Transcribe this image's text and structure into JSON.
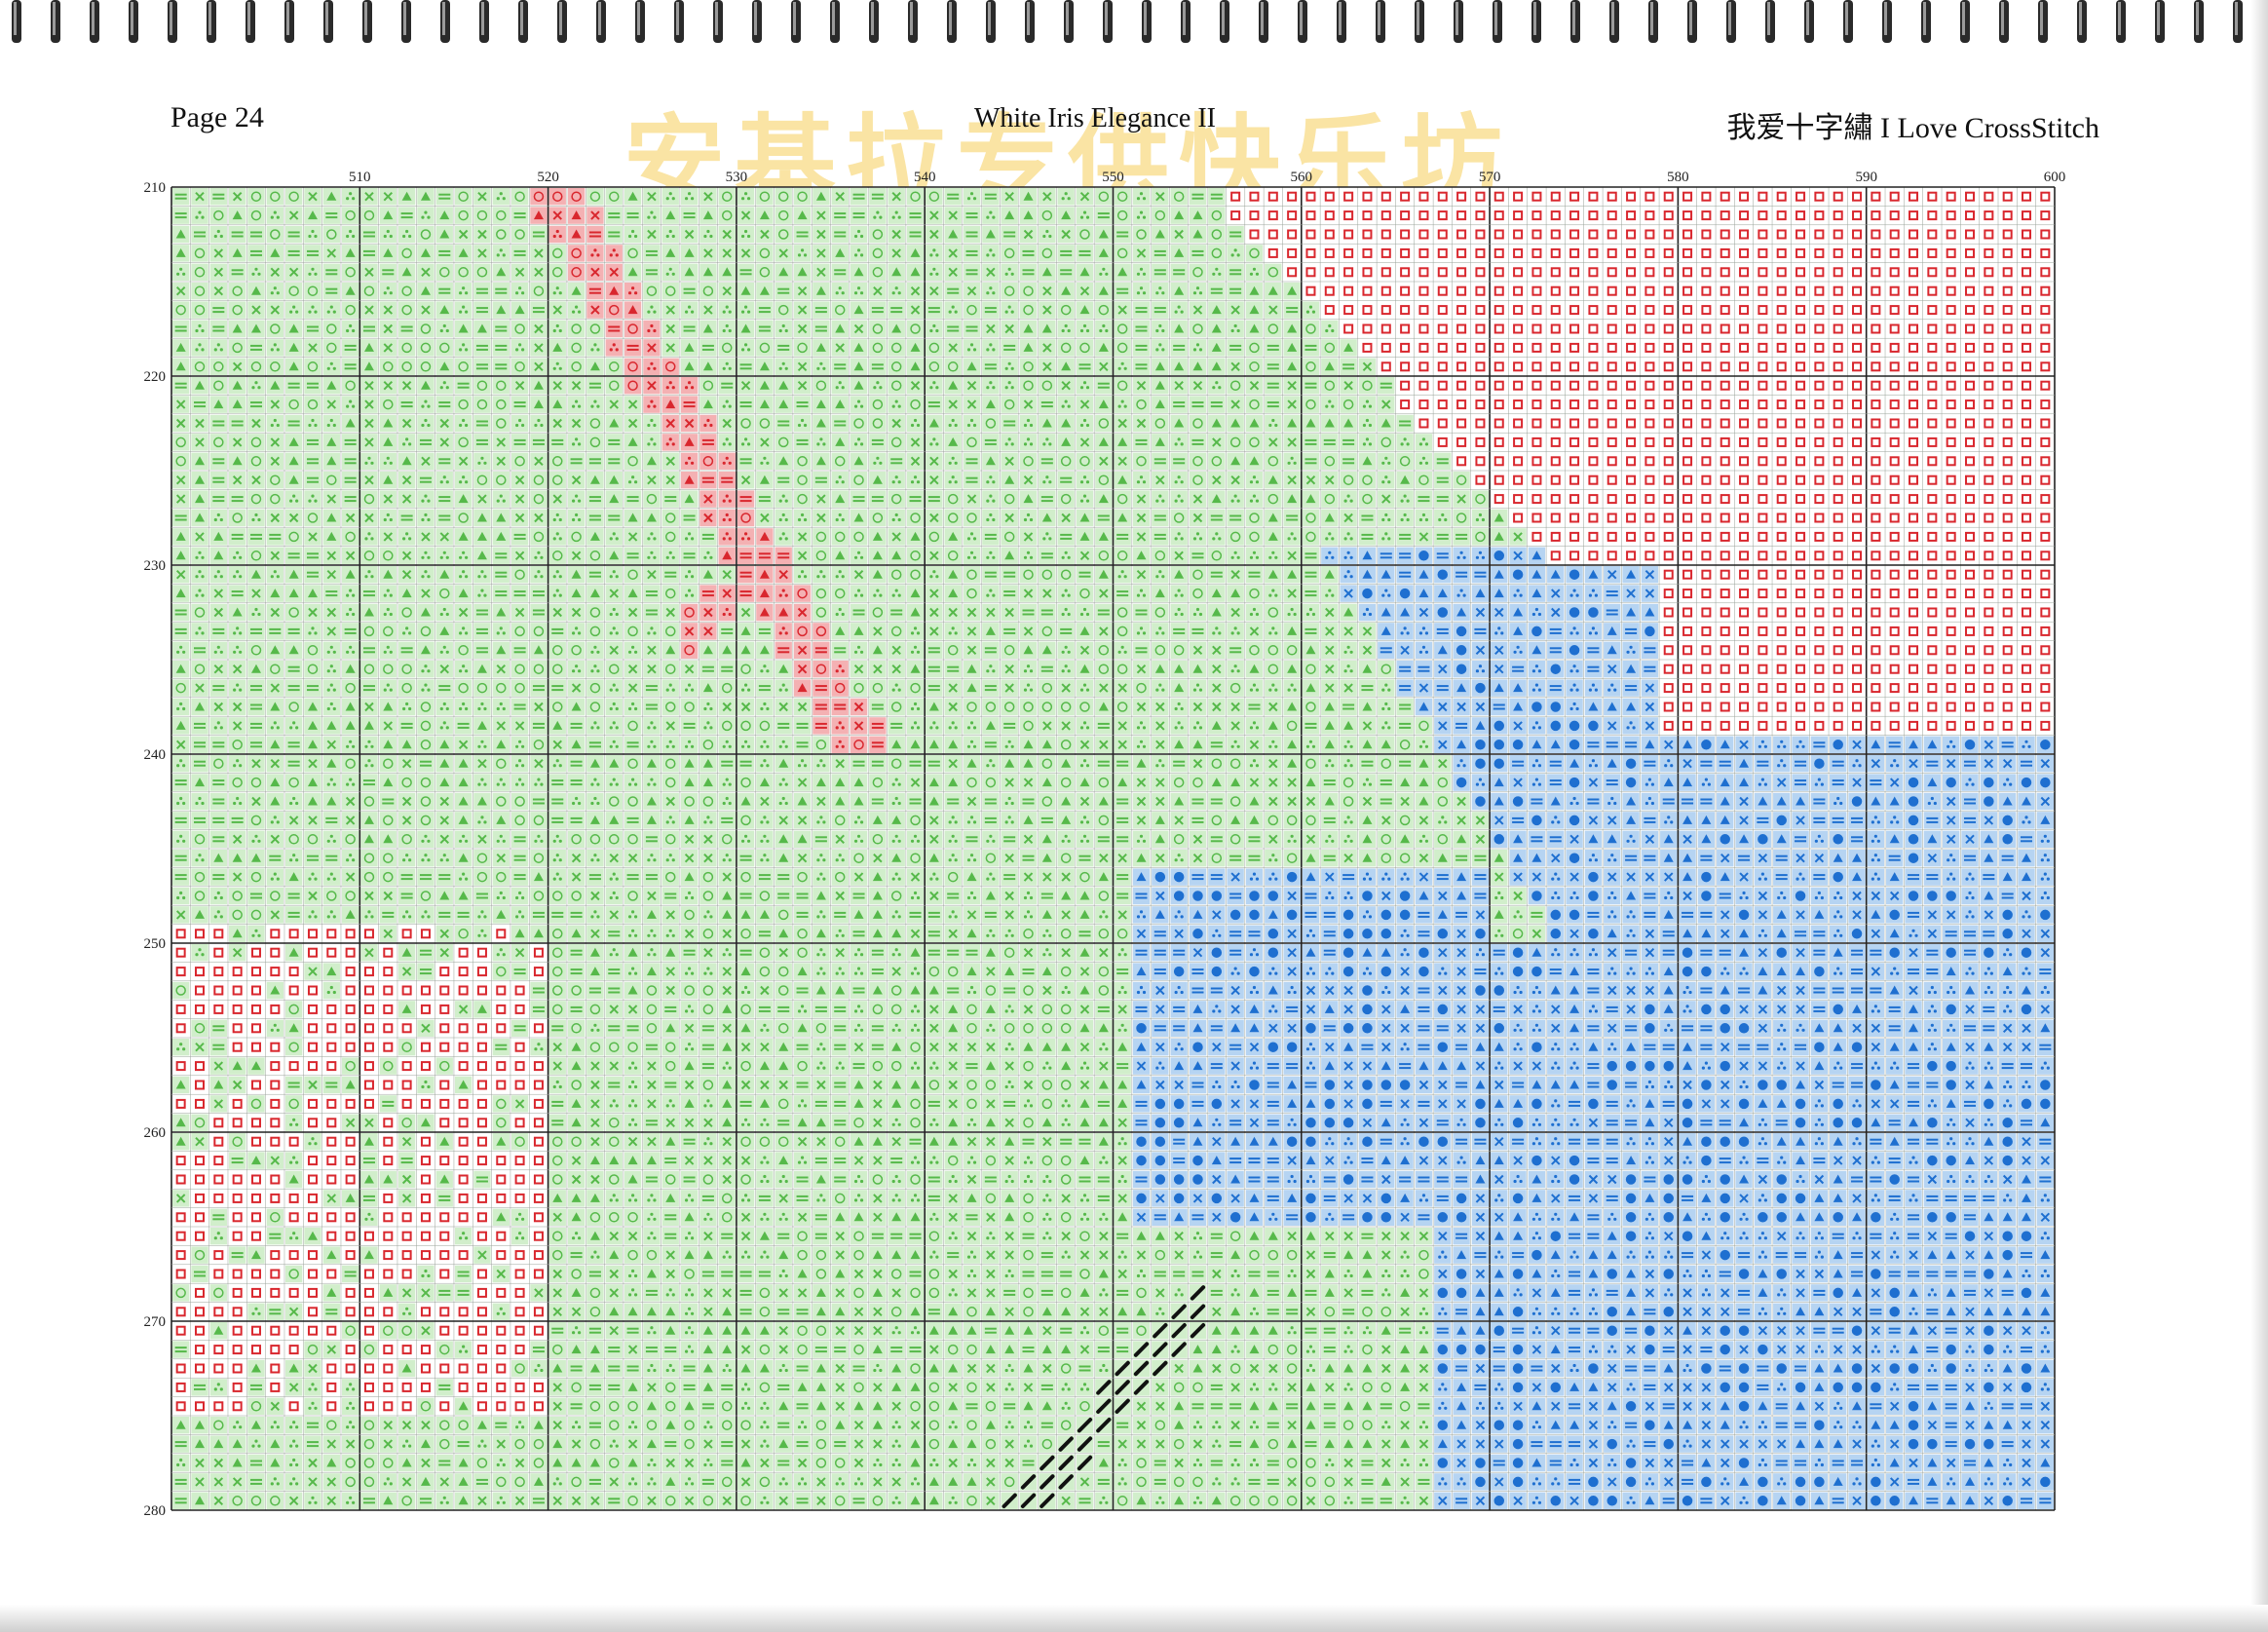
{
  "header": {
    "page_number": "Page 24",
    "title": "White Iris Elegance II",
    "site_credit": "我爱十字繡 I Love CrossStitch"
  },
  "watermark": "安基拉专供快乐坊",
  "chart_data": {
    "type": "cross-stitch-pattern",
    "columns": {
      "start": 500,
      "end": 600,
      "label_step": 10,
      "labels": [
        "510",
        "520",
        "530",
        "540",
        "550",
        "560",
        "570",
        "580",
        "590",
        "600"
      ]
    },
    "rows": {
      "start": 210,
      "end": 280,
      "label_step": 10,
      "labels": [
        "210",
        "220",
        "230",
        "240",
        "250",
        "260",
        "270",
        "280"
      ]
    },
    "grid": true,
    "colors": {
      "red": "#d9272e",
      "pink": "#f2a3a6",
      "green": "#56b94a",
      "light_green": "#c9ebc2",
      "blue": "#1e6fd0",
      "light_blue": "#a9cdf0",
      "black": "#111111",
      "gray": "#8c8c9e"
    }
  }
}
